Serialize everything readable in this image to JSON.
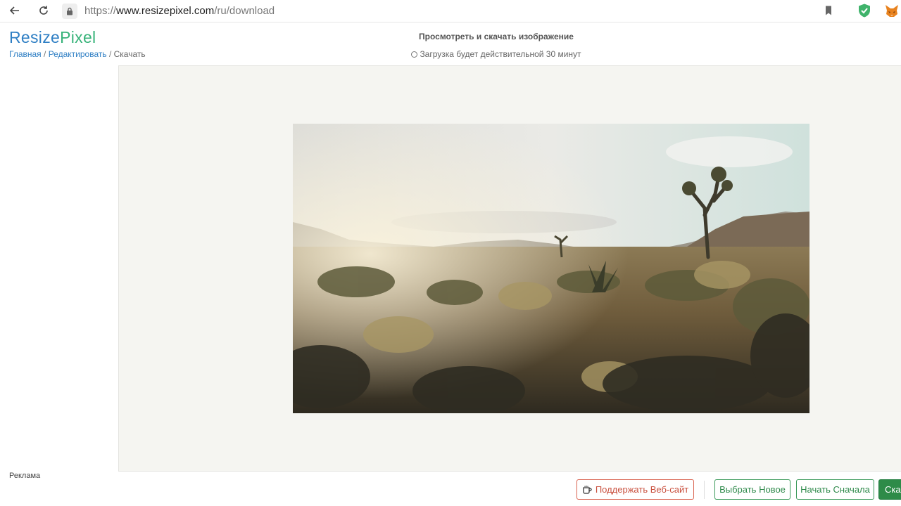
{
  "browser": {
    "url_prefix": "https://",
    "url_host": "www.resizepixel.com",
    "url_path": "/ru/download"
  },
  "header": {
    "logo_part1": "Resize",
    "logo_part2": "Pixel",
    "breadcrumb": {
      "home": "Главная",
      "edit": "Редактировать",
      "current": "Скачать",
      "separator": " / "
    },
    "title": "Просмотреть и скачать изображение",
    "expire_note": "Загрузка будет действительной 30 минут"
  },
  "sidebar": {
    "ad_label": "Реклама"
  },
  "actions": {
    "support": "Поддержать Веб-сайт",
    "choose_new": "Выбрать Новое",
    "start_over": "Начать Сначала",
    "download": "Скачать"
  },
  "colors": {
    "brand_blue": "#2f7fc4",
    "brand_green": "#38b37a",
    "support_red": "#c9503e",
    "action_green": "#2e8b48"
  }
}
